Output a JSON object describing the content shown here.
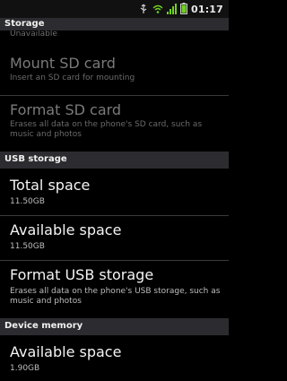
{
  "status_bar": {
    "time": "01:17",
    "icons": [
      "usb-icon",
      "wifi-icon",
      "signal-icon",
      "battery-icon"
    ],
    "battery_color": "#6fd11f"
  },
  "sections": {
    "storage": {
      "header": "Storage",
      "partial_text": "Unavailable",
      "mount": {
        "title": "Mount SD card",
        "summary": "Insert an SD card for mounting"
      },
      "format": {
        "title": "Format SD card",
        "summary": "Erases all data on the phone's SD card, such as music and photos"
      }
    },
    "usb_storage": {
      "header": "USB storage",
      "total": {
        "title": "Total space",
        "value": "11.50GB"
      },
      "available": {
        "title": "Available space",
        "value": "11.50GB"
      },
      "format": {
        "title": "Format USB storage",
        "summary": "Erases all data on the phone's USB storage, such as music and photos"
      }
    },
    "device_memory": {
      "header": "Device memory",
      "available": {
        "title": "Available space",
        "value": "1.90GB"
      }
    }
  }
}
